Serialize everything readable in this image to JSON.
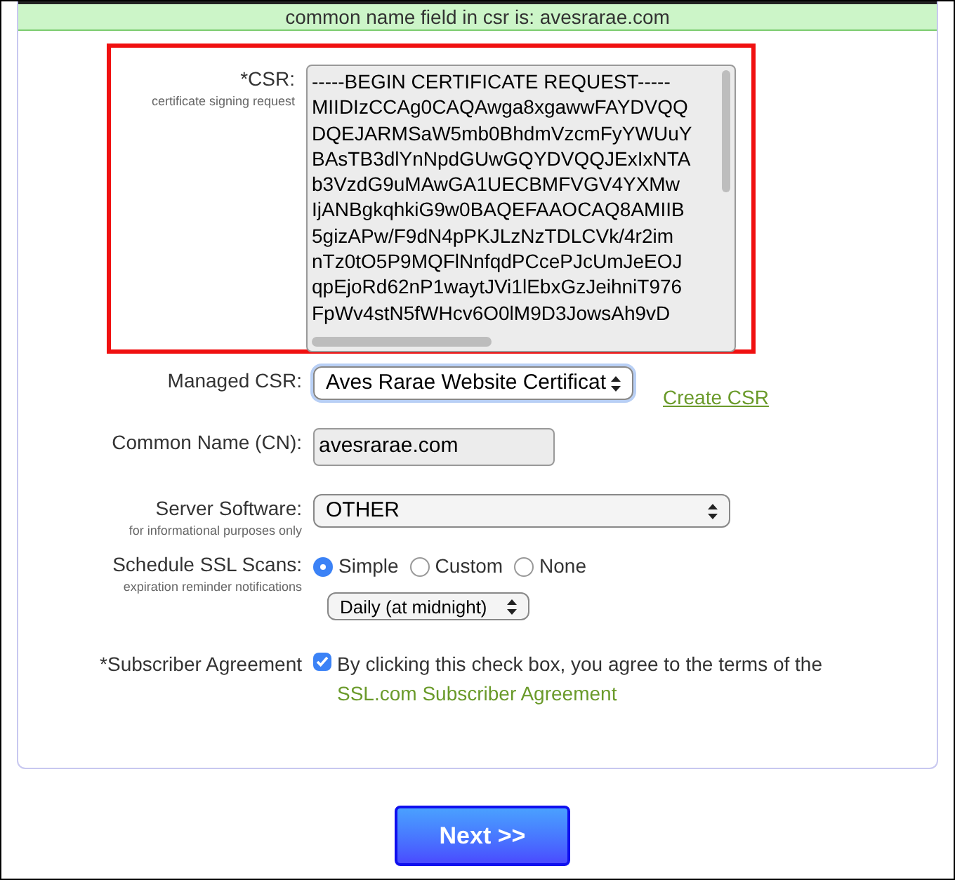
{
  "banner": "common name field in csr is: avesrarae.com",
  "csr": {
    "label": "*CSR:",
    "hint": "certificate signing request",
    "lines": [
      "-----BEGIN CERTIFICATE REQUEST-----",
      "MIIDIzCCAg0CAQAwga8xgawwFAYDVQQ",
      "DQEJARMSaW5mb0BhdmVzcmFyYWUuY",
      "BAsTB3dlYnNpdGUwGQYDVQQJExIxNTA",
      "b3VzdG9uMAwGA1UECBMFVGV4YXMw",
      "IjANBgkqhkiG9w0BAQEFAAOCAQ8AMIIB",
      "5gizAPw/F9dN4pPKJLzNzTDLCVk/4r2im",
      "nTz0tO5P9MQFlNnfqdPCcePJcUmJeEOJ",
      "qpEjoRd62nP1waytJVi1lEbxGzJeihniT976",
      "FpWv4stN5fWHcv6O0lM9D3JowsAh9vD"
    ]
  },
  "managed_csr": {
    "label": "Managed CSR:",
    "value": "Aves Rarae Website Certificat",
    "link": "Create CSR"
  },
  "common_name": {
    "label": "Common Name (CN):",
    "value": "avesrarae.com"
  },
  "server_software": {
    "label": "Server Software:",
    "hint": "for informational purposes only",
    "value": "OTHER"
  },
  "ssl_scans": {
    "label": "Schedule SSL Scans:",
    "hint": "expiration reminder notifications",
    "options": [
      {
        "label": "Simple",
        "selected": true
      },
      {
        "label": "Custom",
        "selected": false
      },
      {
        "label": "None",
        "selected": false
      }
    ],
    "frequency": "Daily (at midnight)"
  },
  "agreement": {
    "label": "*Subscriber Agreement",
    "checked": true,
    "text": "By clicking this check box, you agree to the terms of the",
    "link": "SSL.com Subscriber Agreement"
  },
  "next_button": "Next >>"
}
